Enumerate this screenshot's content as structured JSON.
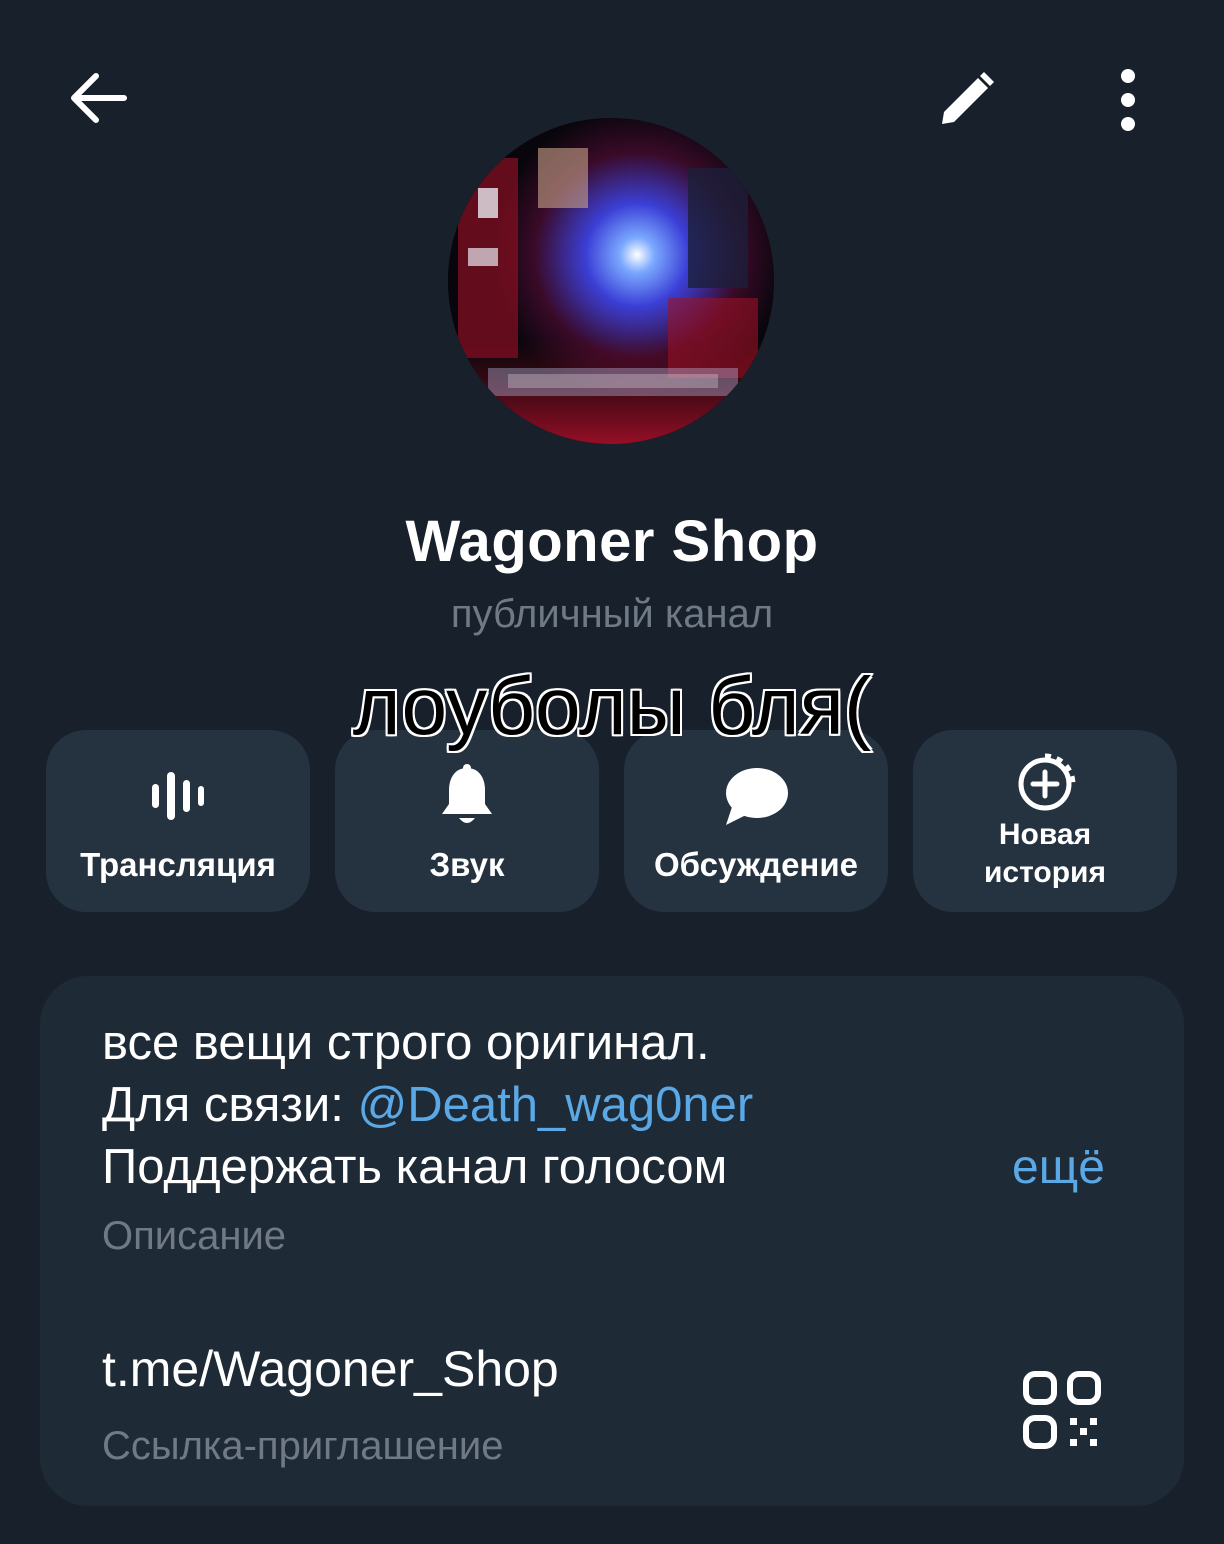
{
  "header": {
    "back_icon": "arrow-left-icon",
    "edit_icon": "pencil-icon",
    "menu_icon": "more-vertical-icon"
  },
  "profile": {
    "name": "Wagoner Shop",
    "type": "публичный канал"
  },
  "overlay_caption": "лоуболы бля(",
  "actions": [
    {
      "label": "Трансляция",
      "icon": "live-stream-icon"
    },
    {
      "label": "Звук",
      "icon": "bell-icon"
    },
    {
      "label": "Обсуждение",
      "icon": "chat-bubble-icon"
    },
    {
      "label_line1": "Новая",
      "label_line2": "история",
      "icon": "story-add-icon"
    }
  ],
  "info": {
    "description_line1": "все вещи строго оригинал.",
    "description_line2_prefix": "Для связи: ",
    "description_mention": "@Death_wag0ner",
    "description_line3": "Поддержать канал голосом",
    "more_label": "ещё",
    "description_caption": "Описание",
    "link": "t.me/Wagoner_Shop",
    "link_caption": "Ссылка-приглашение",
    "qr_icon": "qr-code-icon"
  },
  "colors": {
    "background": "#17202b",
    "card": "#1f2a37",
    "button": "#253240",
    "accent_link": "#5aa9e6",
    "secondary_text": "#6f7a86"
  }
}
